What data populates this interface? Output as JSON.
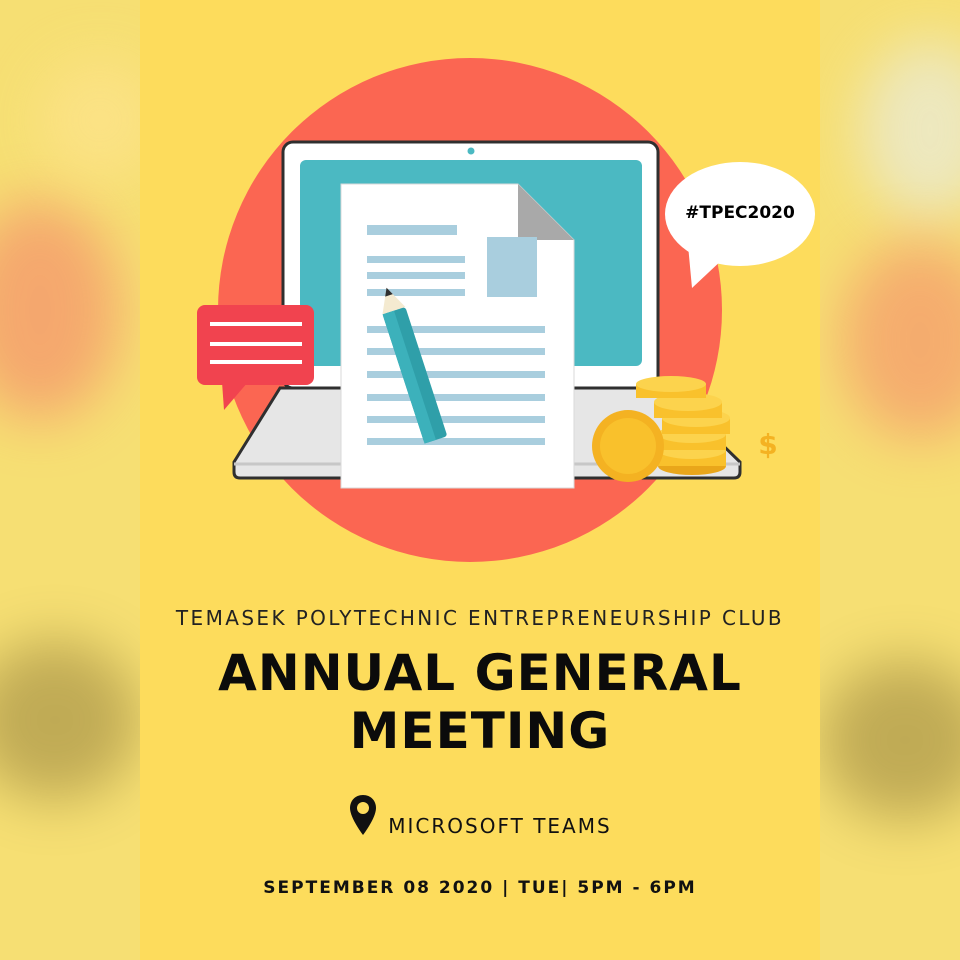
{
  "poster": {
    "hashtag": "#TPEC2020",
    "organizer": "TEMASEK POLYTECHNIC ENTREPRENEURSHIP CLUB",
    "title_line1": "ANNUAL GENERAL",
    "title_line2": "MEETING",
    "location": "MICROSOFT TEAMS",
    "location_icon": "map-pin-icon",
    "date_line": "SEPTEMBER 08 2020 | TUE| 5PM - 6PM",
    "currency_symbol": "$"
  },
  "colors": {
    "background": "#fddc5c",
    "circle": "#fb6652",
    "screen": "#4bb9c2",
    "speech_bubble_red": "#f1434f",
    "coin": "#f9c12c",
    "text_dark": "#0b0b0b"
  }
}
